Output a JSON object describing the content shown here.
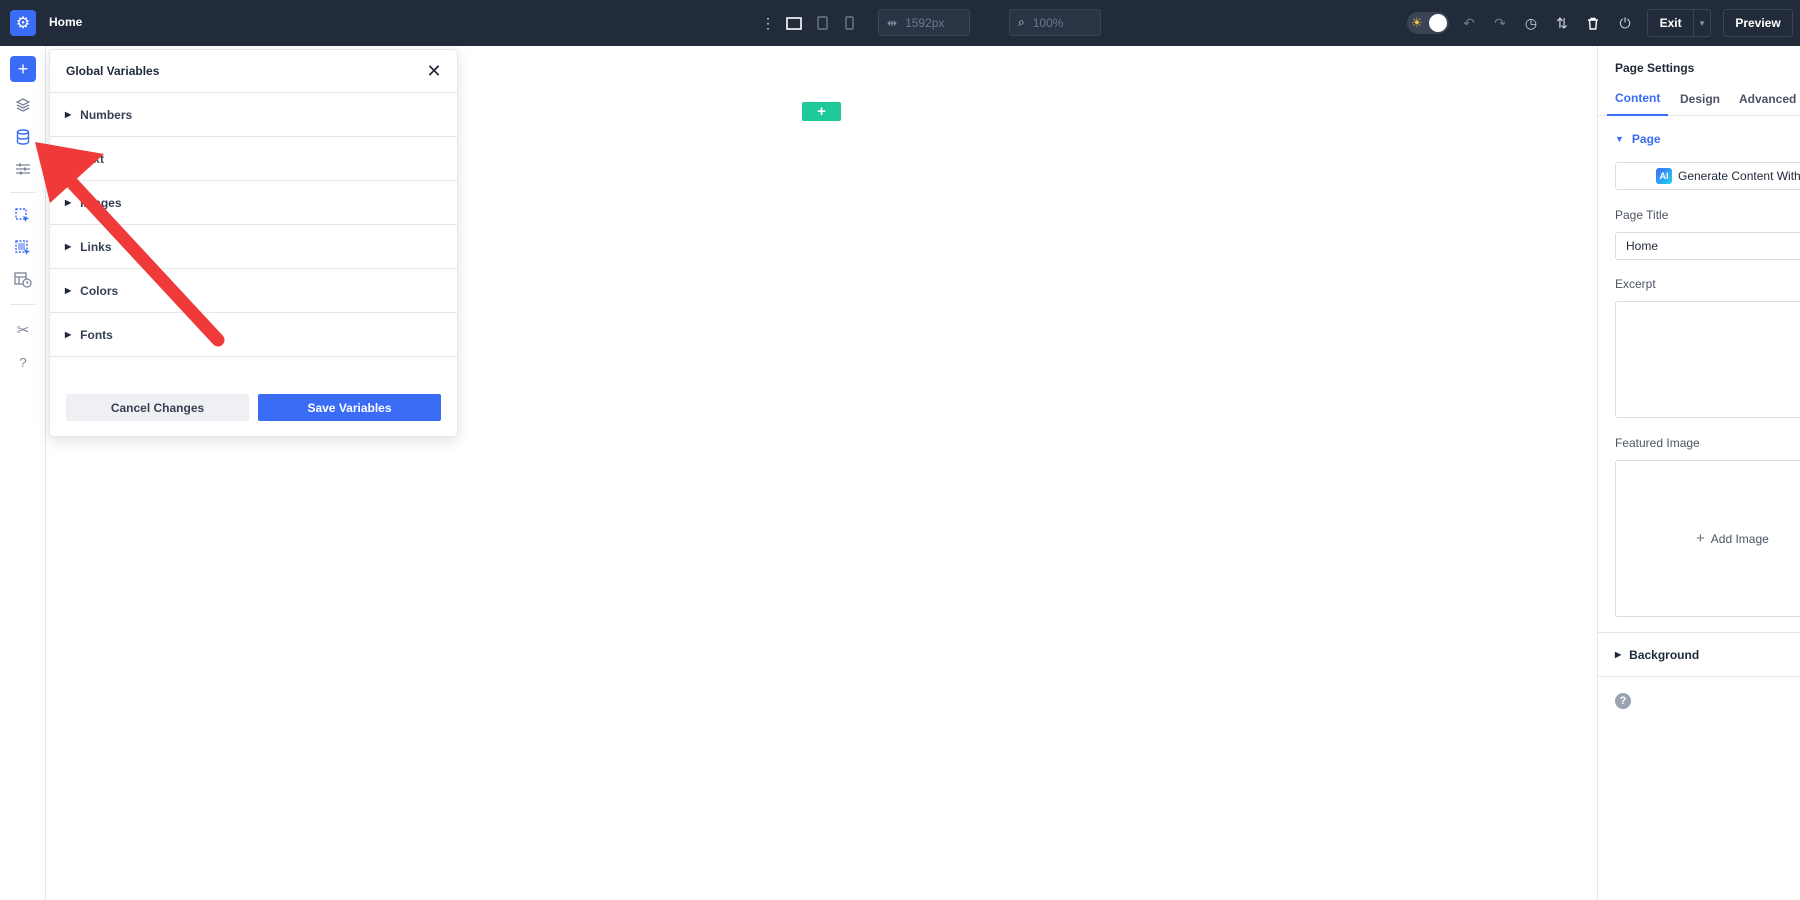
{
  "topbar": {
    "page_name": "Home",
    "width_value": "1592px",
    "zoom_value": "100%",
    "exit_label": "Exit",
    "preview_label": "Preview"
  },
  "global_variables": {
    "title": "Global Variables",
    "items": [
      {
        "label": "Numbers"
      },
      {
        "label": "Text"
      },
      {
        "label": "Images"
      },
      {
        "label": "Links"
      },
      {
        "label": "Colors"
      },
      {
        "label": "Fonts"
      }
    ],
    "cancel_label": "Cancel Changes",
    "save_label": "Save Variables"
  },
  "page_settings": {
    "title": "Page Settings",
    "tabs": [
      {
        "label": "Content",
        "active": true
      },
      {
        "label": "Design"
      },
      {
        "label": "Advanced"
      }
    ],
    "section_label": "Page",
    "ai_badge": "AI",
    "ai_button_label": "Generate Content With AI",
    "page_title_label": "Page Title",
    "page_title_value": "Home",
    "excerpt_label": "Excerpt",
    "featured_image_label": "Featured Image",
    "add_image_label": "Add Image",
    "background_label": "Background"
  },
  "colors": {
    "topbar_bg": "#222b3a",
    "accent": "#3b6cf6",
    "add_section_green": "#1fc99a",
    "annotation_arrow": "#f03a3a"
  }
}
